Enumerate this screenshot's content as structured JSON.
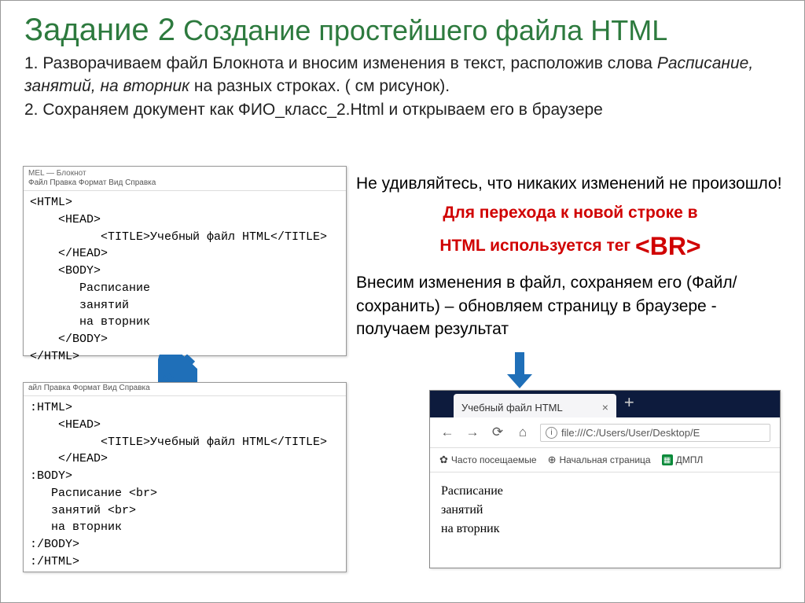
{
  "title": {
    "prefix": "Задание 2",
    "main": "Создание простейшего файла HTML"
  },
  "instructions": {
    "line1_a": "1. Разворачиваем файл Блокнота и вносим изменения в текст, расположив слова ",
    "line1_italic": "Расписание, занятий, на вторник",
    "line1_b": " на разных строках. ( см рисунок).",
    "line2": "2. Сохраняем документ как ФИО_класс_2.Html и открываем его в браузере"
  },
  "notepad1": {
    "title": "MEL — Блокнот",
    "menu": "Файл  Правка  Формат  Вид  Справка",
    "content": "<HTML>\n    <HEAD>\n          <TITLE>Учебный файл HTML</TITLE>\n    </HEAD>\n    <BODY>\n       Расписание\n       занятий\n       на вторник\n    </BODY>\n</HTML>"
  },
  "notepad2": {
    "menu": "айл  Правка  Формат  Вид  Справка",
    "content": ":HTML>\n    <HEAD>\n          <TITLE>Учебный файл HTML</TITLE>\n    </HEAD>\n:BODY>\n   Расписание <br>\n   занятий <br>\n   на вторник\n:/BODY>\n:/HTML>"
  },
  "right": {
    "para1": "Не удивляйтесь, что никаких изменений не произошло!",
    "red1": "Для перехода к новой строке в",
    "red2a": "HTML используется тег ",
    "red2b": "<BR>",
    "para2": "Внесим изменения в файл, сохраняем его (Файл/сохранить) – обновляем страницу в браузере - получаем результат"
  },
  "browser": {
    "tab_title": "Учебный файл HTML",
    "url": "file:///C:/Users/User/Desktop/E",
    "bookmarks": {
      "frequent": "Часто посещаемые",
      "start": "Начальная страница",
      "dmpl": "ДМПЛ"
    },
    "page": {
      "l1": "Расписание",
      "l2": "занятий",
      "l3": "на вторник"
    }
  }
}
